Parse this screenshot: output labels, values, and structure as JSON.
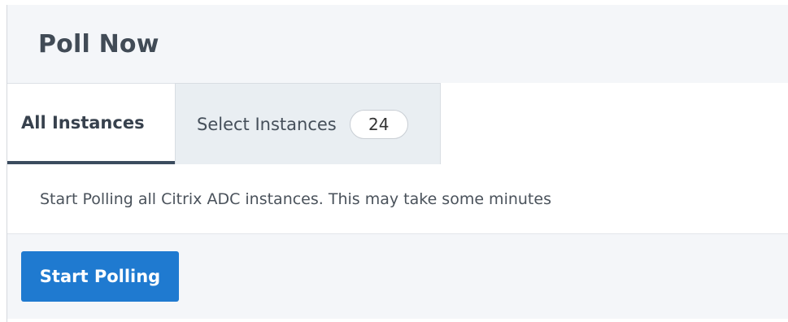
{
  "dialog": {
    "title": "Poll Now"
  },
  "tabs": [
    {
      "label": "All Instances",
      "active": true
    },
    {
      "label": "Select Instances",
      "count": "24",
      "active": false
    }
  ],
  "message": "Start Polling all Citrix ADC instances. This may take some minutes",
  "actions": {
    "start_polling_label": "Start Polling"
  },
  "colors": {
    "primary_button": "#1f7ad0",
    "header_bg": "#f4f6f9",
    "active_tab_underline": "#3b4c5e",
    "inactive_tab_bg": "#e9eef2"
  }
}
